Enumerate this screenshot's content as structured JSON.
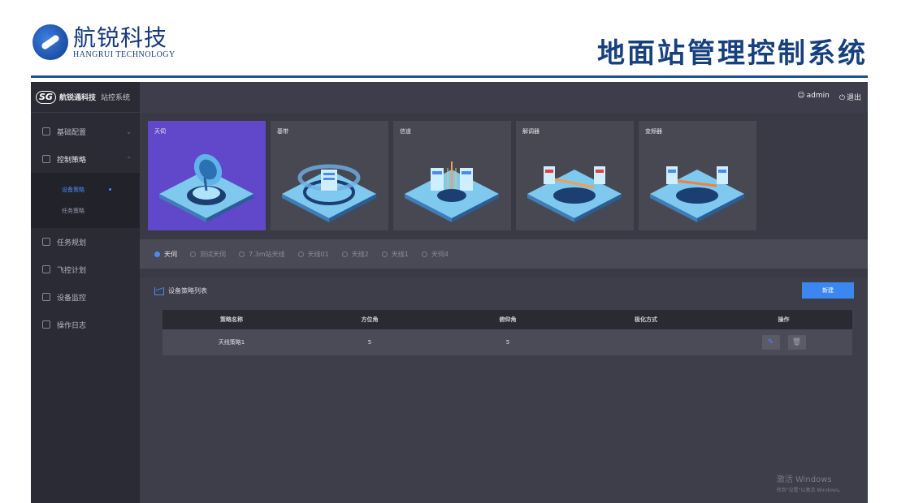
{
  "slide": {
    "logo_cn": "航锐科技",
    "logo_en": "HANGRUI TECHNOLOGY",
    "title": "地面站管理控制系统"
  },
  "app": {
    "brand_mark": "SG",
    "brand_name": "航锐通科技",
    "brand_sys": "站控系统",
    "user": "admin",
    "logout": "退出"
  },
  "sidebar": {
    "items": [
      {
        "label": "基础配置"
      },
      {
        "label": "控制策略"
      },
      {
        "label": "任务规划"
      },
      {
        "label": "飞控计划"
      },
      {
        "label": "设备监控"
      },
      {
        "label": "操作日志"
      }
    ],
    "submenu": [
      {
        "label": "设备策略"
      },
      {
        "label": "任务策略"
      }
    ]
  },
  "cards": [
    {
      "label": "天伺",
      "icon": "antenna-icon"
    },
    {
      "label": "基带",
      "icon": "baseband-icon"
    },
    {
      "label": "信道",
      "icon": "channel-icon"
    },
    {
      "label": "解调器",
      "icon": "demodulator-icon"
    },
    {
      "label": "变频器",
      "icon": "converter-icon"
    }
  ],
  "filters": [
    {
      "label": "天伺"
    },
    {
      "label": "测试天伺"
    },
    {
      "label": "7.3m站天线"
    },
    {
      "label": "天线01"
    },
    {
      "label": "天线2"
    },
    {
      "label": "天线1"
    },
    {
      "label": "天伺4"
    }
  ],
  "panel": {
    "title": "设备策略列表",
    "new_button": "新建"
  },
  "table": {
    "headers": [
      "策略名称",
      "方位角",
      "俯仰角",
      "极化方式",
      "操作"
    ],
    "rows": [
      {
        "name": "天线策略1",
        "azimuth": "5",
        "elevation": "5",
        "polarization": ""
      }
    ]
  },
  "watermark": {
    "line1": "激活 Windows",
    "line2": "转到\"设置\"以激活 Windows。"
  },
  "colors": {
    "accent": "#4a8af4",
    "active_card": "#6147c9",
    "title": "#16407e"
  }
}
